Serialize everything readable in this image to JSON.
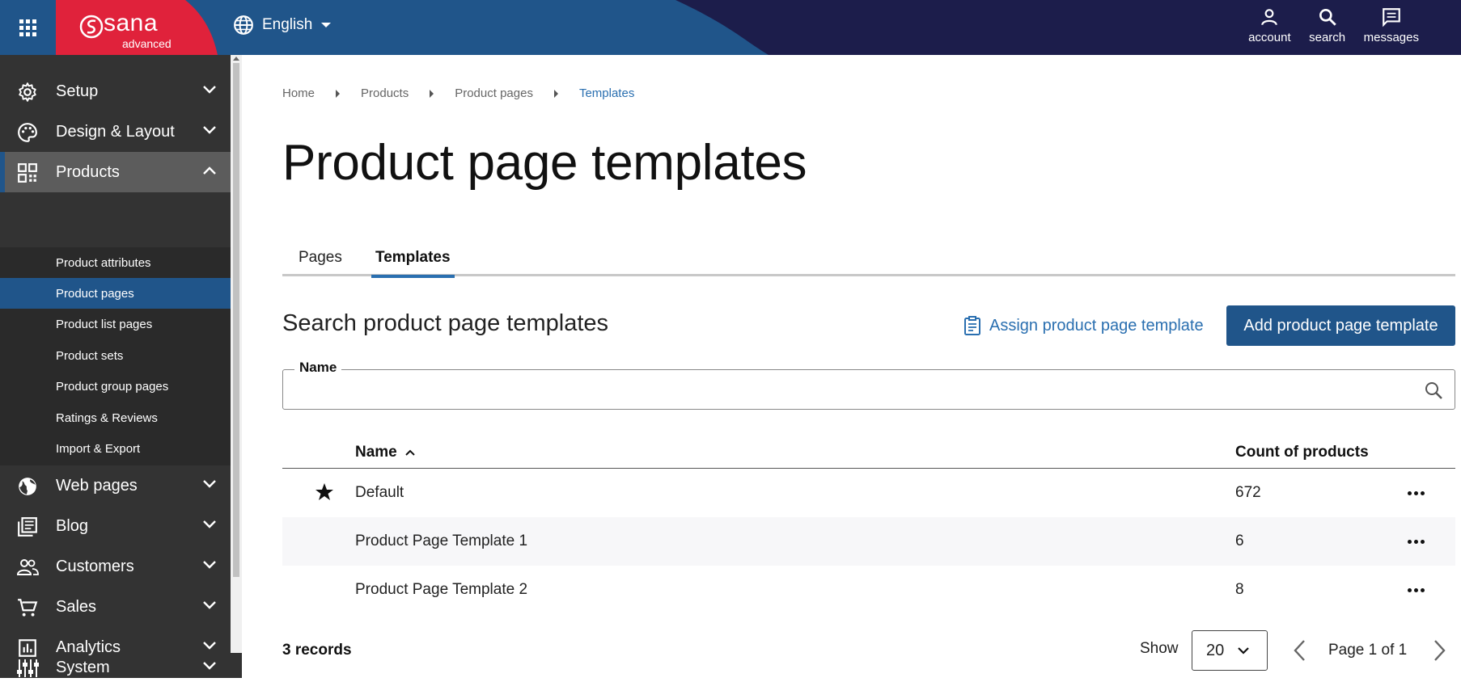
{
  "header": {
    "brand": "sana",
    "brand_sub": "advanced",
    "language": "English",
    "actions": [
      {
        "label": "account",
        "icon": "account-icon"
      },
      {
        "label": "search",
        "icon": "search-icon"
      },
      {
        "label": "messages",
        "icon": "messages-icon"
      }
    ]
  },
  "sidebar": {
    "items": [
      {
        "label": "Setup",
        "icon": "gear-icon"
      },
      {
        "label": "Design & Layout",
        "icon": "palette-icon"
      },
      {
        "label": "Products",
        "icon": "qr-grid-icon"
      },
      {
        "label": "Web pages",
        "icon": "globe-icon"
      },
      {
        "label": "Blog",
        "icon": "blog-icon"
      },
      {
        "label": "Customers",
        "icon": "people-icon"
      },
      {
        "label": "Sales",
        "icon": "cart-icon"
      },
      {
        "label": "Analytics",
        "icon": "analytics-icon"
      },
      {
        "label": "System",
        "icon": "sliders-icon"
      }
    ],
    "products_sub": [
      "Product attributes",
      "Product pages",
      "Product list pages",
      "Product sets",
      "Product group pages",
      "Ratings & Reviews",
      "Import & Export"
    ]
  },
  "breadcrumb": [
    "Home",
    "Products",
    "Product pages",
    "Templates"
  ],
  "page_title": "Product page templates",
  "tabs": [
    "Pages",
    "Templates"
  ],
  "search_section": {
    "title": "Search product page templates",
    "assign_label": "Assign product page template",
    "add_label": "Add product page template",
    "field_label": "Name",
    "field_value": ""
  },
  "table": {
    "columns": [
      "Name",
      "Count of products"
    ],
    "rows": [
      {
        "name": "Default",
        "count": "672",
        "default": true
      },
      {
        "name": "Product Page Template 1",
        "count": "6",
        "default": false
      },
      {
        "name": "Product Page Template 2",
        "count": "8",
        "default": false
      }
    ]
  },
  "footer": {
    "records": "3 records",
    "show_label": "Show",
    "page_size": "20",
    "page_info": "Page 1 of 1"
  },
  "colors": {
    "accent": "#20558a",
    "brand_red": "#e0223b",
    "topbar": "#1c1d4b",
    "sidebar": "#333333",
    "link": "#2a6fb0"
  }
}
